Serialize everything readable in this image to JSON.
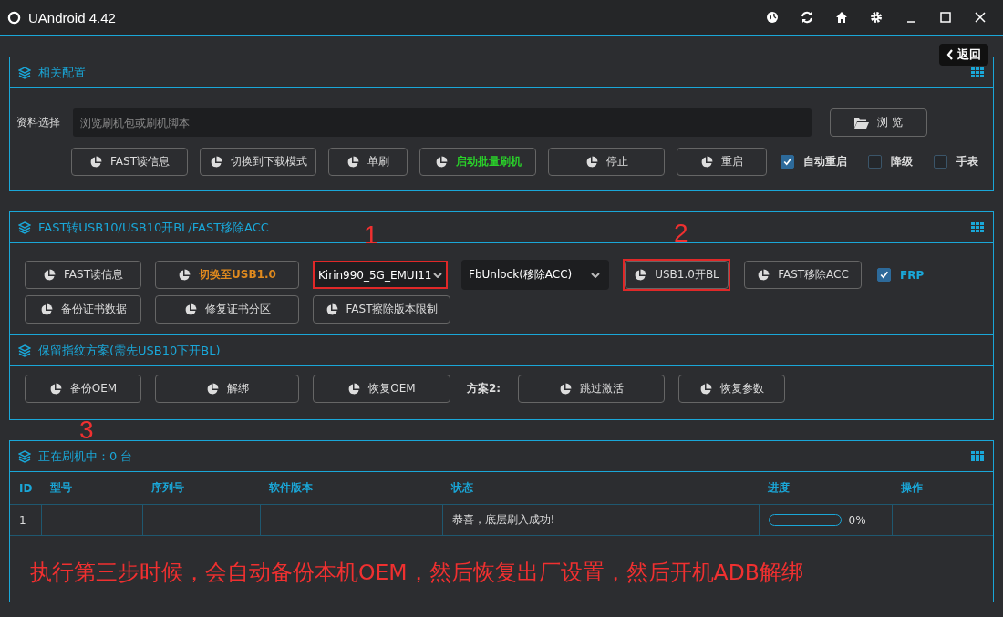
{
  "window": {
    "title": "UAndroid 4.42"
  },
  "back_button": {
    "label": "返回"
  },
  "config_panel": {
    "title": "相关配置",
    "file_label": "资料选择",
    "file_placeholder": "浏览刷机包或刷机脚本",
    "browse_button": "浏 览",
    "buttons": [
      {
        "label": "FAST读信息",
        "kind": "normal"
      },
      {
        "label": "切换到下载模式",
        "kind": "normal"
      },
      {
        "label": "单刷",
        "kind": "normal"
      },
      {
        "label": "启动批量刷机",
        "kind": "go"
      },
      {
        "label": "停止",
        "kind": "normal"
      },
      {
        "label": "重启",
        "kind": "normal"
      }
    ],
    "options": [
      {
        "label": "自动重启",
        "checked": true
      },
      {
        "label": "降级",
        "checked": false
      },
      {
        "label": "手表",
        "checked": false
      }
    ]
  },
  "fast_panel": {
    "title": "FAST转USB10/USB10开BL/FAST移除ACC",
    "row1": [
      {
        "kind": "button",
        "label": "FAST读信息",
        "warning": false
      },
      {
        "kind": "button",
        "label": "切换至USB1.0",
        "warning": true
      },
      {
        "kind": "select",
        "value": "Kirin990_5G_EMUI11",
        "annotation": "1"
      },
      {
        "kind": "select-dark",
        "value": "FbUnlock(移除ACC)"
      },
      {
        "kind": "button",
        "label": "USB1.0开BL",
        "warning": false,
        "annotation": "2"
      },
      {
        "kind": "button",
        "label": "FAST移除ACC",
        "warning": false
      },
      {
        "kind": "checkbox",
        "label": "FRP",
        "checked": true
      }
    ],
    "row2": [
      {
        "label": "备份证书数据"
      },
      {
        "label": "修复证书分区"
      },
      {
        "label": "FAST擦除版本限制"
      }
    ],
    "fingerprint_title": "保留指纹方案(需先USB10下开BL)",
    "fingerprint_buttons": [
      {
        "label": "备份OEM"
      },
      {
        "label": "解绑"
      },
      {
        "label": "恢复OEM"
      }
    ],
    "plan2_label": "方案2:",
    "plan2_buttons": [
      {
        "label": "跳过激活"
      },
      {
        "label": "恢复参数"
      }
    ]
  },
  "devices_panel": {
    "title": "正在刷机中：0 台",
    "annotation": "3",
    "table": {
      "columns": [
        "ID",
        "型号",
        "序列号",
        "软件版本",
        "状态",
        "进度",
        "操作"
      ],
      "rows": [
        {
          "id": "1",
          "model": "",
          "serial": "",
          "version": "",
          "status": "恭喜，底层刷入成功!",
          "level": 0,
          "percent": "0%"
        }
      ]
    }
  },
  "note": "执行第三步时候，会自动备份本机OEM，然后恢复出厂设置，然后开机ADB解绑"
}
